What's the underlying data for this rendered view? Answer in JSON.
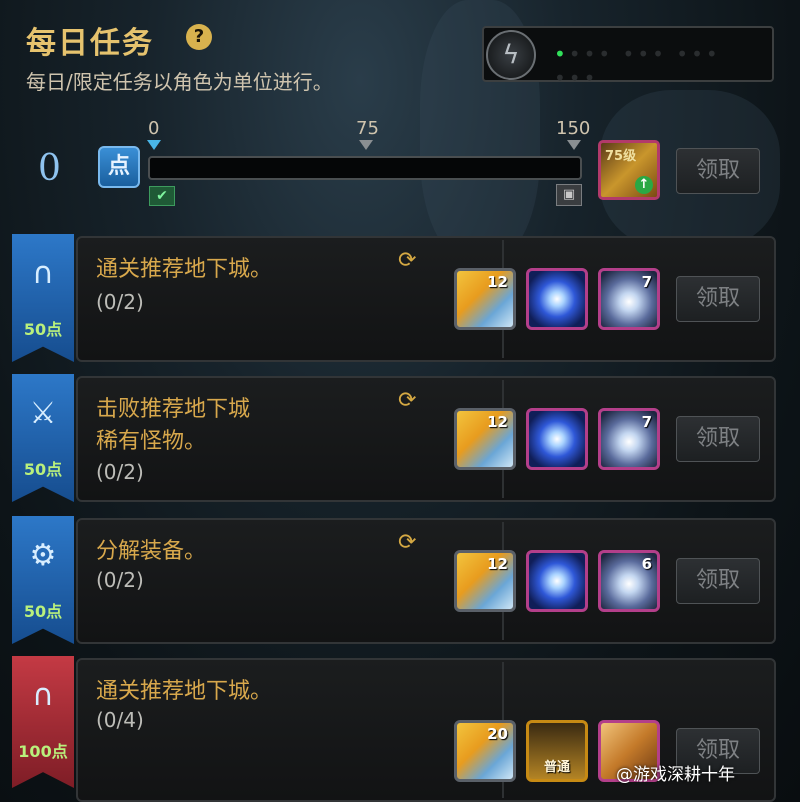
{
  "header": {
    "title": "每日任务",
    "help_icon": "question-icon",
    "help_glyph": "?",
    "subtitle": "每日/限定任务以角色为单位进行。"
  },
  "energy": {
    "icon": "lightning-icon",
    "icon_glyph": "ϟ",
    "dots": "•••  •••  •••  •••"
  },
  "points": {
    "current": "0",
    "badge": "点",
    "max": 150,
    "progress_fraction": 0,
    "ticks": [
      "0",
      "75",
      "150"
    ],
    "claim_label": "领取",
    "reward_level_text": "75级",
    "reward_icon": "weapon-box-icon"
  },
  "tasks": [
    {
      "points": "50点",
      "ribbon_color": "blue",
      "icon": "dungeon-gate-icon",
      "icon_glyph": "∩",
      "name_lines": [
        "通关推荐地下城。"
      ],
      "progress": "(0/2)",
      "claim_label": "领取",
      "rewards": [
        {
          "icon": "gold-crystal-icon",
          "count": "12"
        },
        {
          "icon": "blue-orb-icon",
          "count": ""
        },
        {
          "icon": "silver-orb-icon",
          "count": "7"
        }
      ]
    },
    {
      "points": "50点",
      "ribbon_color": "blue",
      "icon": "sword-shield-icon",
      "icon_glyph": "⚔",
      "name_lines": [
        "击败推荐地下城",
        "稀有怪物。"
      ],
      "progress": "(0/2)",
      "claim_label": "领取",
      "rewards": [
        {
          "icon": "gold-crystal-icon",
          "count": "12"
        },
        {
          "icon": "blue-orb-icon",
          "count": ""
        },
        {
          "icon": "silver-orb-icon",
          "count": "7"
        }
      ]
    },
    {
      "points": "50点",
      "ribbon_color": "blue",
      "icon": "gear-icon",
      "icon_glyph": "⚙",
      "name_lines": [
        "分解装备。"
      ],
      "progress": "(0/2)",
      "claim_label": "领取",
      "rewards": [
        {
          "icon": "gold-crystal-icon",
          "count": "12"
        },
        {
          "icon": "blue-orb-icon",
          "count": ""
        },
        {
          "icon": "silver-orb-icon",
          "count": "6"
        }
      ]
    },
    {
      "points": "100点",
      "ribbon_color": "red",
      "icon": "dungeon-gate-icon",
      "icon_glyph": "∩",
      "name_lines": [
        "通关推荐地下城。"
      ],
      "progress": "(0/4)",
      "claim_label": "领取",
      "rewards": [
        {
          "icon": "gold-crystal-icon",
          "count": "20"
        },
        {
          "icon": "treasure-chest-icon",
          "count": "",
          "tag": "普通"
        },
        {
          "icon": "golden-box-icon",
          "count": ""
        }
      ]
    }
  ],
  "watermark": "@游戏深耕十年"
}
